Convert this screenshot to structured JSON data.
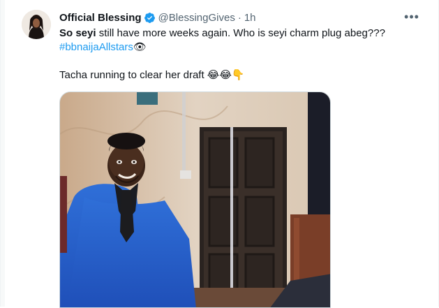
{
  "author": {
    "name": "Official Blessing",
    "handle": "@BlessingGives",
    "separator": "·",
    "time": "1h",
    "verified": true
  },
  "tweet": {
    "bold_text": "So seyi",
    "text_rest": " still have more weeks again. Who is seyi charm plug abeg???",
    "hashtag": "#bbnaija",
    "hashtag2": "Allstars",
    "hashtag_emoji": "👁",
    "line2_text": "Tacha running to clear her draft ",
    "line2_emojis": "😂😂👇"
  },
  "more_icon": "more-icon",
  "colors": {
    "link": "#1d9bf0",
    "verified": "#1d9bf0",
    "muted": "#536471"
  }
}
